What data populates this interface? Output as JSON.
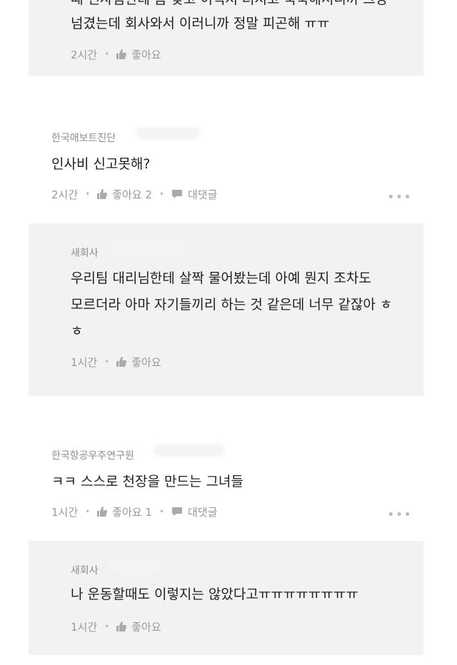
{
  "comments": [
    {
      "type": "reply",
      "lines": [
        "때 인사팀한테 좀 맞고 이럭저 러저고 국국해서니까 그냥",
        "넘겼는데 회사와서 이러니까 정말 피곤해 ㅠㅠ"
      ],
      "time": "2시간",
      "like": "좋아요"
    },
    {
      "type": "comment",
      "author": "한국애보트진단",
      "text": "인사비 신고못해?",
      "time": "2시간",
      "like": "좋아요 2",
      "reply": "대댓글",
      "more": "•••"
    },
    {
      "type": "reply",
      "author": "새회사",
      "lines": [
        "우리팀 대리님한테 살짝 물어봤는데 아예 뭔지 조차도",
        "모르더라 아마 자기들끼리 하는 것 같은데 너무 같잖아 ㅎ",
        "ㅎ"
      ],
      "time": "1시간",
      "like": "좋아요"
    },
    {
      "type": "comment",
      "author": "한국항공우주연구원",
      "text": "ㅋㅋ 스스로 천장을 만드는 그녀들",
      "time": "1시간",
      "like": "좋아요 1",
      "reply": "대댓글",
      "more": "•••"
    },
    {
      "type": "reply",
      "author": "새회사",
      "lines": [
        "나 운동할때도 이렇지는 않았다고ㅠㅠㅠㅠㅠㅠㅠㅠ"
      ],
      "time": "1시간",
      "like": "좋아요"
    }
  ],
  "colors": {
    "reply_bg": "#f2f2f3",
    "meta": "#999999",
    "name": "#8d8d8d"
  }
}
